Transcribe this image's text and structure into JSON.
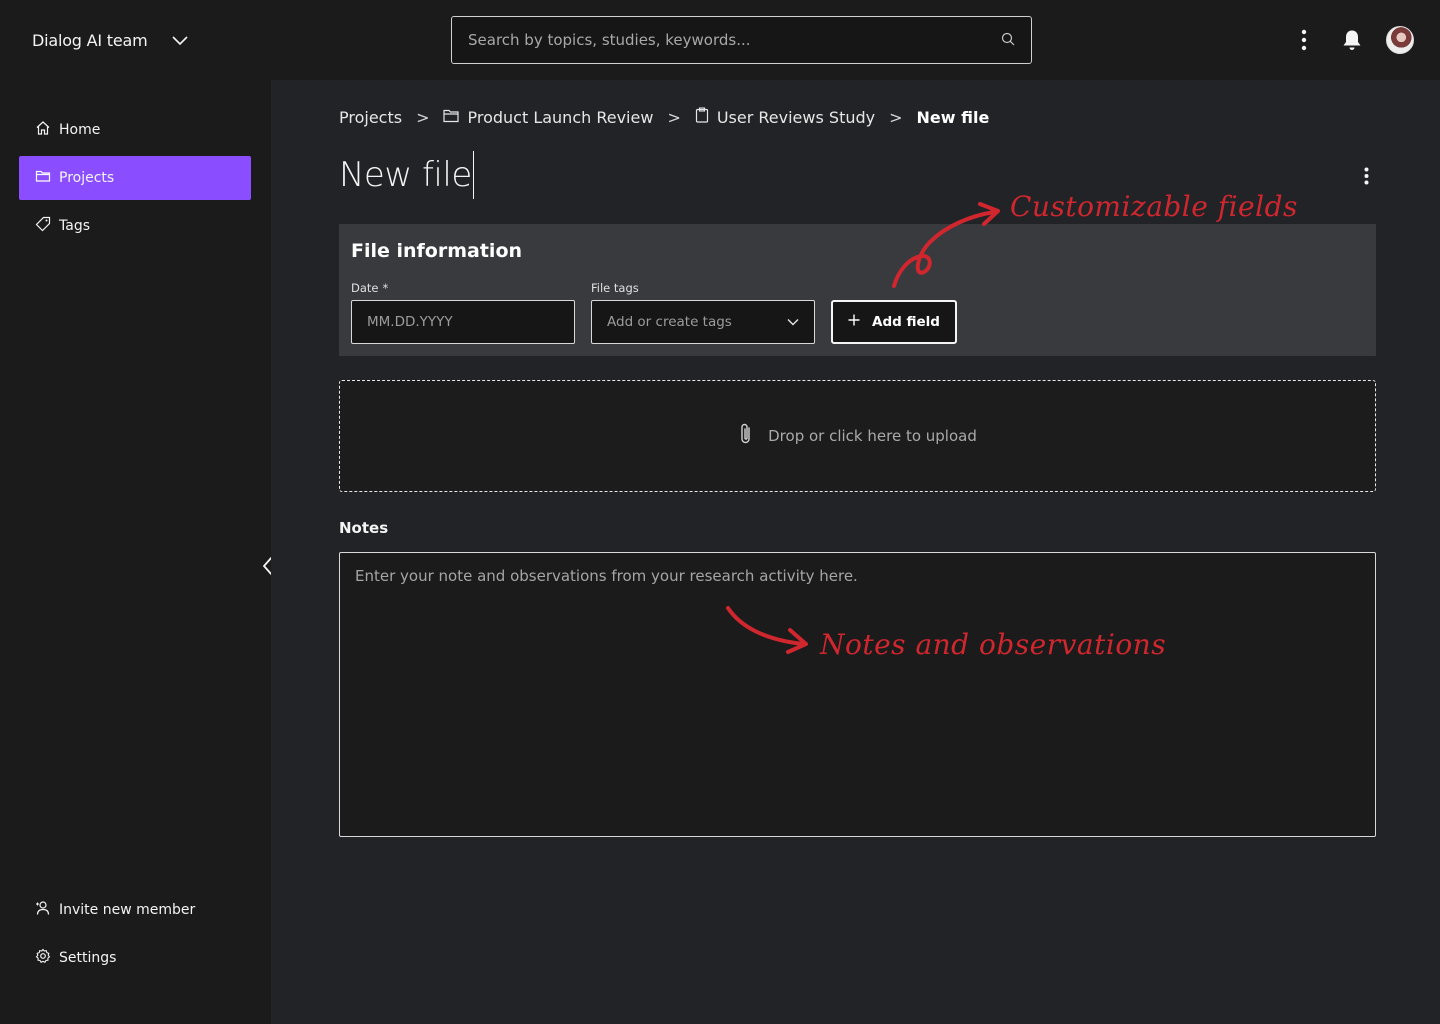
{
  "header": {
    "team_name": "Dialog AI team",
    "search_placeholder": "Search by topics, studies, keywords...",
    "icons": [
      "chevron-down-icon",
      "search-icon",
      "overflow-menu-icon",
      "bell-icon",
      "avatar"
    ]
  },
  "sidebar": {
    "items": [
      {
        "label": "Home",
        "icon": "home-icon"
      },
      {
        "label": "Projects",
        "icon": "folder-icon",
        "active": true
      },
      {
        "label": "Tags",
        "icon": "tag-icon"
      }
    ],
    "bottom_items": [
      {
        "label": "Invite new member",
        "icon": "user-add-icon"
      },
      {
        "label": "Settings",
        "icon": "gear-icon"
      }
    ]
  },
  "breadcrumb": {
    "items": [
      "Projects",
      "Product Launch Review",
      "User Reviews Study",
      "New file"
    ],
    "separator": ">"
  },
  "page": {
    "title": "New file"
  },
  "file_info": {
    "heading": "File information",
    "date_label": "Date",
    "date_required": "*",
    "date_placeholder": "MM.DD.YYYY",
    "tags_label": "File tags",
    "tags_placeholder": "Add or create tags",
    "add_field_label": "Add field"
  },
  "upload": {
    "text": "Drop or click here to upload"
  },
  "notes": {
    "label": "Notes",
    "placeholder": "Enter your note and observations from your research activity here."
  },
  "annotations": {
    "customizable": "Customizable fields",
    "notes": "Notes and observations"
  },
  "colors": {
    "accent": "#8a4dff",
    "annotation": "#d0262e",
    "background": "#1b1b1c",
    "panel": "#222327"
  }
}
